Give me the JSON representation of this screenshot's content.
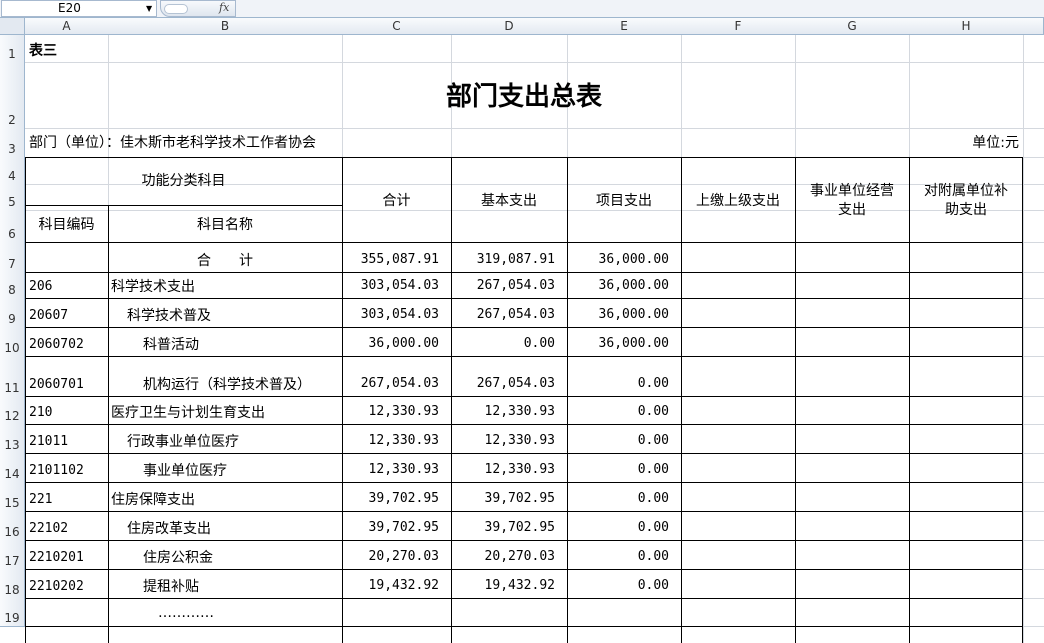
{
  "namebox": "E20",
  "fx_label": "fx",
  "columns": [
    "A",
    "B",
    "C",
    "D",
    "E",
    "F",
    "G",
    "H"
  ],
  "row_numbers": [
    "1",
    "2",
    "3",
    "4",
    "5",
    "6",
    "7",
    "8",
    "9",
    "10",
    "11",
    "12",
    "13",
    "14",
    "15",
    "16",
    "17",
    "18",
    "19"
  ],
  "sheet": {
    "table_label": "表三",
    "title": "部门支出总表",
    "department": "部门（单位）：佳木斯市老科学技术工作者协会",
    "unit": "单位:元",
    "headers": {
      "func_class": "功能分类科目",
      "code": "科目编码",
      "name": "科目名称",
      "total": "合计",
      "basic": "基本支出",
      "project": "项目支出",
      "upper": "上缴上级支出",
      "business_line1": "事业单位经营",
      "business_line2": "支出",
      "subsidy_line1": "对附属单位补",
      "subsidy_line2": "助支出"
    },
    "rows": [
      {
        "code": "",
        "name": "合　　计",
        "total": "355,087.91",
        "basic": "319,087.91",
        "project": "36,000.00"
      },
      {
        "code": "206",
        "name": "科学技术支出",
        "total": "303,054.03",
        "basic": "267,054.03",
        "project": "36,000.00"
      },
      {
        "code": "20607",
        "name": "科学技术普及",
        "total": "303,054.03",
        "basic": "267,054.03",
        "project": "36,000.00"
      },
      {
        "code": "2060702",
        "name": "科普活动",
        "total": "36,000.00",
        "basic": "0.00",
        "project": "36,000.00"
      },
      {
        "code": "2060701",
        "name": "机构运行（科学技术普及）",
        "total": "267,054.03",
        "basic": "267,054.03",
        "project": "0.00"
      },
      {
        "code": "210",
        "name": "医疗卫生与计划生育支出",
        "total": "12,330.93",
        "basic": "12,330.93",
        "project": "0.00"
      },
      {
        "code": "21011",
        "name": "行政事业单位医疗",
        "total": "12,330.93",
        "basic": "12,330.93",
        "project": "0.00"
      },
      {
        "code": "2101102",
        "name": "事业单位医疗",
        "total": "12,330.93",
        "basic": "12,330.93",
        "project": "0.00"
      },
      {
        "code": "221",
        "name": "住房保障支出",
        "total": "39,702.95",
        "basic": "39,702.95",
        "project": "0.00"
      },
      {
        "code": "22102",
        "name": "住房改革支出",
        "total": "39,702.95",
        "basic": "39,702.95",
        "project": "0.00"
      },
      {
        "code": "2210201",
        "name": "住房公积金",
        "total": "20,270.03",
        "basic": "20,270.03",
        "project": "0.00"
      },
      {
        "code": "2210202",
        "name": "提租补贴",
        "total": "19,432.92",
        "basic": "19,432.92",
        "project": "0.00"
      }
    ],
    "ellipsis": "…………"
  }
}
